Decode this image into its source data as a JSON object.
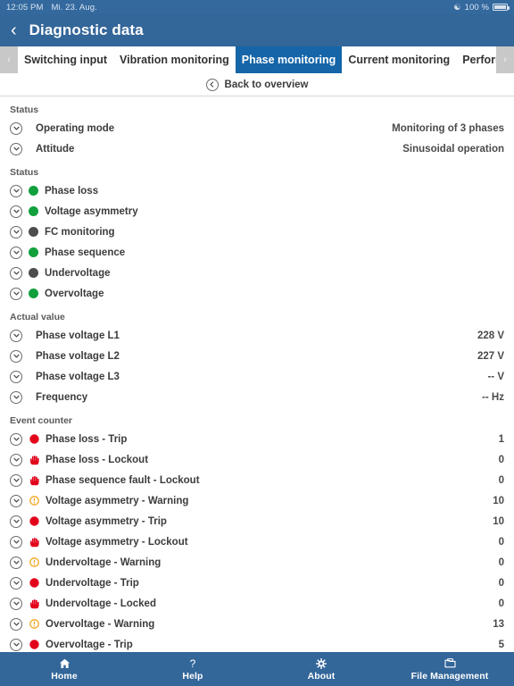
{
  "statusbar": {
    "time": "12:05 PM",
    "date": "Mi. 23. Aug.",
    "battery_percent": "100 %",
    "wifi_icon": "wifi-icon",
    "battery_icon": "battery-icon"
  },
  "header": {
    "back_icon": "back-chevron-icon",
    "title": "Diagnostic data"
  },
  "tabbar": {
    "prev_icon": "chevron-left-icon",
    "next_icon": "chevron-right-icon",
    "active_tab": "Phase monitoring",
    "tabs": [
      {
        "label": "Switching input",
        "active": false
      },
      {
        "label": "Vibration monitoring",
        "active": false
      },
      {
        "label": "Phase monitoring",
        "active": true
      },
      {
        "label": "Current monitoring",
        "active": false
      },
      {
        "label": "Performance",
        "active": false
      }
    ],
    "active_color": "#1565a8"
  },
  "back_to_overview": {
    "icon": "circle-chevron-left-icon",
    "label": "Back to overview"
  },
  "sections": [
    {
      "title": "Status",
      "kind": "plain",
      "rows": [
        {
          "label": "Operating mode",
          "value": "Monitoring of 3 phases",
          "expand_icon": "circle-chevron-down-icon"
        },
        {
          "label": "Attitude",
          "value": "Sinusoidal operation",
          "expand_icon": "circle-chevron-down-icon"
        }
      ]
    },
    {
      "title": "Status",
      "kind": "status",
      "rows": [
        {
          "label": "Phase loss",
          "indicator": "green",
          "expand_icon": "circle-chevron-down-icon"
        },
        {
          "label": "Voltage asymmetry",
          "indicator": "green",
          "expand_icon": "circle-chevron-down-icon"
        },
        {
          "label": "FC monitoring",
          "indicator": "grey",
          "expand_icon": "circle-chevron-down-icon"
        },
        {
          "label": "Phase sequence",
          "indicator": "green",
          "expand_icon": "circle-chevron-down-icon"
        },
        {
          "label": "Undervoltage",
          "indicator": "grey",
          "expand_icon": "circle-chevron-down-icon"
        },
        {
          "label": "Overvoltage",
          "indicator": "green",
          "expand_icon": "circle-chevron-down-icon"
        }
      ]
    },
    {
      "title": "Actual value",
      "kind": "plain",
      "rows": [
        {
          "label": "Phase voltage L1",
          "value": "228 V",
          "expand_icon": "circle-chevron-down-icon"
        },
        {
          "label": "Phase voltage L2",
          "value": "227 V",
          "expand_icon": "circle-chevron-down-icon"
        },
        {
          "label": "Phase voltage L3",
          "value": "-- V",
          "expand_icon": "circle-chevron-down-icon"
        },
        {
          "label": "Frequency",
          "value": "-- Hz",
          "expand_icon": "circle-chevron-down-icon"
        }
      ]
    },
    {
      "title": "Event counter",
      "kind": "events",
      "rows": [
        {
          "label": "Phase loss - Trip",
          "value": "1",
          "indicator": "trip",
          "expand_icon": "circle-chevron-down-icon"
        },
        {
          "label": "Phase loss - Lockout",
          "value": "0",
          "indicator": "lockout",
          "expand_icon": "circle-chevron-down-icon"
        },
        {
          "label": "Phase sequence fault - Lockout",
          "value": "0",
          "indicator": "lockout",
          "expand_icon": "circle-chevron-down-icon"
        },
        {
          "label": "Voltage asymmetry - Warning",
          "value": "10",
          "indicator": "warning",
          "expand_icon": "circle-chevron-down-icon"
        },
        {
          "label": "Voltage asymmetry - Trip",
          "value": "10",
          "indicator": "trip",
          "expand_icon": "circle-chevron-down-icon"
        },
        {
          "label": "Voltage asymmetry - Lockout",
          "value": "0",
          "indicator": "lockout",
          "expand_icon": "circle-chevron-down-icon"
        },
        {
          "label": "Undervoltage - Warning",
          "value": "0",
          "indicator": "warning",
          "expand_icon": "circle-chevron-down-icon"
        },
        {
          "label": "Undervoltage - Trip",
          "value": "0",
          "indicator": "trip",
          "expand_icon": "circle-chevron-down-icon"
        },
        {
          "label": "Undervoltage - Locked",
          "value": "0",
          "indicator": "lockout",
          "expand_icon": "circle-chevron-down-icon"
        },
        {
          "label": "Overvoltage - Warning",
          "value": "13",
          "indicator": "warning",
          "expand_icon": "circle-chevron-down-icon"
        },
        {
          "label": "Overvoltage - Trip",
          "value": "5",
          "indicator": "trip",
          "expand_icon": "circle-chevron-down-icon"
        }
      ]
    }
  ],
  "bottomnav": {
    "items": [
      {
        "label": "Home",
        "icon": "home-icon"
      },
      {
        "label": "Help",
        "icon": "question-mark-icon"
      },
      {
        "label": "About",
        "icon": "gear-icon"
      },
      {
        "label": "File Management",
        "icon": "folder-icon"
      }
    ]
  },
  "colors": {
    "brand_blue": "#336699",
    "tab_active_blue": "#1565a8",
    "ok_green": "#12a03c",
    "inactive_grey": "#4d4d4d",
    "alarm_red": "#e2001a",
    "warning_orange": "#f5a623"
  }
}
